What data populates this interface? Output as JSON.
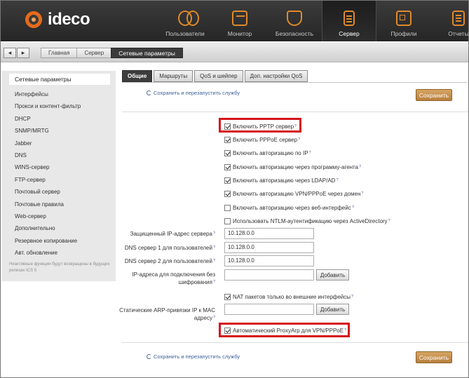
{
  "app": {
    "logo_text": "ideco"
  },
  "nav": [
    {
      "label": "Пользователи",
      "icon": "users-icon"
    },
    {
      "label": "Монитор",
      "icon": "monitor-icon"
    },
    {
      "label": "Безопасность",
      "icon": "shield-icon"
    },
    {
      "label": "Сервер",
      "icon": "server-icon",
      "active": true
    },
    {
      "label": "Профили",
      "icon": "profiles-icon"
    },
    {
      "label": "Отчеты",
      "icon": "reports-icon"
    }
  ],
  "breadcrumb": {
    "back": "◂",
    "forward": "▸",
    "items": [
      "Главная",
      "Сервер",
      "Сетевые параметры"
    ]
  },
  "sidebar": {
    "items": [
      "Сетевые параметры",
      "Интерфейсы",
      "Прокси и контент-фильтр",
      "DHCP",
      "SNMP/MRTG",
      "Jabber",
      "DNS",
      "WINS-сервер",
      "FTP-сервер",
      "Почтовый сервер",
      "Почтовые правила",
      "Web-сервер",
      "Дополнительно",
      "Резервное копирование",
      "Авт. обновление"
    ],
    "note": "Неактивные функции будут возвращены в будущих релизах ICS 5"
  },
  "tabs": [
    "Общие",
    "Маршруты",
    "QoS и шейпер",
    "Доп. настройки QoS"
  ],
  "actions": {
    "save_restart": "Сохранить и перезапустить службу",
    "save": "Сохранить",
    "add": "Добавить",
    "help_mark": "?"
  },
  "options": [
    {
      "label": "Включить PPTP сервер",
      "checked": true
    },
    {
      "label": "Включить PPPoE сервер",
      "checked": true
    },
    {
      "label": "Включить авторизацию по IP",
      "checked": true
    },
    {
      "label": "Включить авторизацию через программу-агента",
      "checked": true
    },
    {
      "label": "Включить авторизацию через LDAP/AD",
      "checked": true
    },
    {
      "label": "Включить авторизацию VPN/PPPoE через домен",
      "checked": true
    },
    {
      "label": "Включить авторизацию через веб-интерфейс",
      "checked": false
    },
    {
      "label": "Использовать NTLM-аутентификацию через ActiveDirectory",
      "checked": false
    }
  ],
  "fields": {
    "protected_ip": {
      "label": "Защищенный IP-адрес сервера",
      "value": "10.128.0.0"
    },
    "dns1": {
      "label": "DNS сервер 1 для пользователей",
      "value": "10.128.0.0"
    },
    "dns2": {
      "label": "DNS сервер 2 для пользователей",
      "value": "10.128.0.0"
    },
    "no_encrypt": {
      "label": "IP-адреса для подключения без шифрования",
      "value": ""
    },
    "nat_label": "NAT пакетов только во внешние интерфейсы",
    "nat_checked": true,
    "arp": {
      "label": "Статические ARP-привязки IP к MAC адресу",
      "value": ""
    },
    "proxyarp_label": "Автоматический ProxyArp для VPN/PPPoE",
    "proxyarp_checked": true
  },
  "colors": {
    "accent": "#e08a2a",
    "highlight": "#d5141b",
    "save": "#c8924c"
  }
}
